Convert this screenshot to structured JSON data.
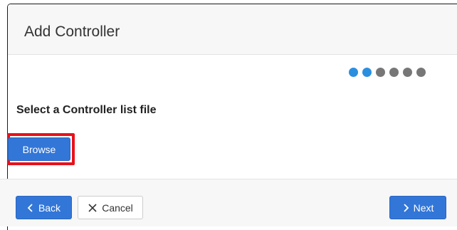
{
  "dialog": {
    "title": "Add Controller"
  },
  "wizard": {
    "total_steps": 6,
    "active_steps": 2,
    "active_color": "#2b8fe0",
    "inactive_color": "#777777"
  },
  "content": {
    "heading": "Select a Controller list file",
    "browse_label": "Browse"
  },
  "footer": {
    "back_label": "Back",
    "cancel_label": "Cancel",
    "next_label": "Next"
  },
  "icons": {
    "back": "chevron-left-icon",
    "cancel": "x-icon",
    "next": "chevron-right-icon"
  },
  "colors": {
    "primary": "#3276d8",
    "highlight": "#e8111a"
  }
}
